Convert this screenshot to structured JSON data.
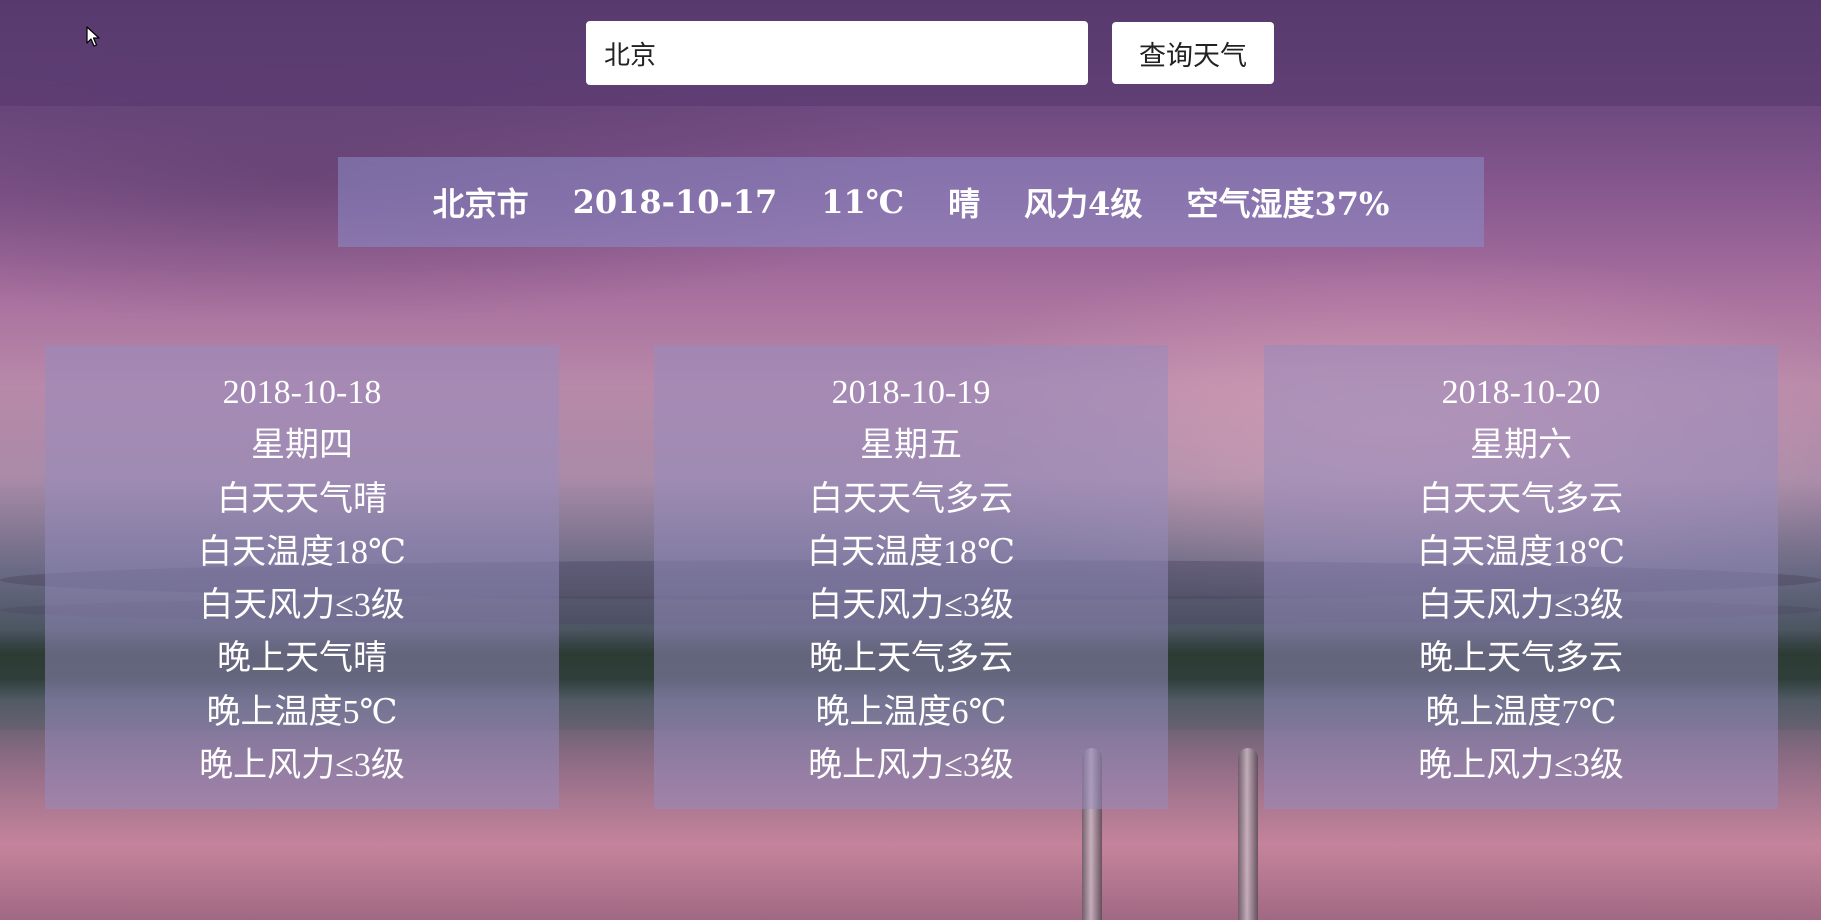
{
  "search": {
    "value": "北京",
    "button_label": "查询天气"
  },
  "current": {
    "city": "北京市",
    "date": "2018-10-17",
    "temperature": "11℃",
    "weather": "晴",
    "wind": "风力4级",
    "humidity": "空气湿度37%"
  },
  "forecast": [
    {
      "date": "2018-10-18",
      "weekday": "星期四",
      "day_weather": "白天天气晴",
      "day_temp": "白天温度18℃",
      "day_wind": "白天风力≤3级",
      "night_weather": "晚上天气晴",
      "night_temp": "晚上温度5℃",
      "night_wind": "晚上风力≤3级"
    },
    {
      "date": "2018-10-19",
      "weekday": "星期五",
      "day_weather": "白天天气多云",
      "day_temp": "白天温度18℃",
      "day_wind": "白天风力≤3级",
      "night_weather": "晚上天气多云",
      "night_temp": "晚上温度6℃",
      "night_wind": "晚上风力≤3级"
    },
    {
      "date": "2018-10-20",
      "weekday": "星期六",
      "day_weather": "白天天气多云",
      "day_temp": "白天温度18℃",
      "day_wind": "白天风力≤3级",
      "night_weather": "晚上天气多云",
      "night_temp": "晚上温度7℃",
      "night_wind": "晚上风力≤3级"
    }
  ],
  "icons": {
    "cursor": "mouse-pointer-icon"
  },
  "colors": {
    "current_bar_bg": "#8c8cc8",
    "card_bg": "#968cbe",
    "top_bar_bg": "#55376e"
  }
}
